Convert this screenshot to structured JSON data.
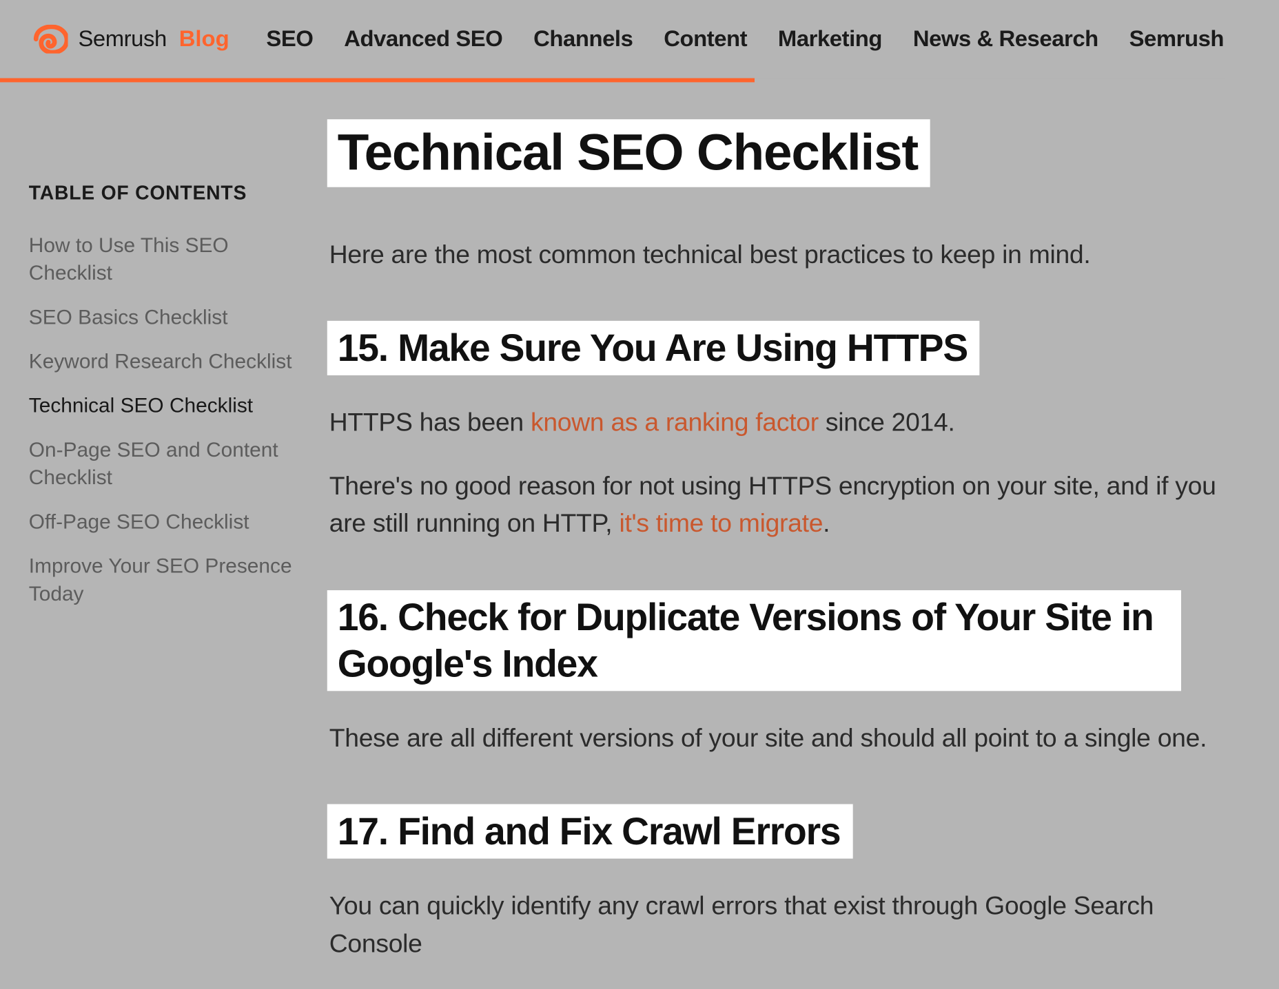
{
  "header": {
    "brand_name": "Semrush",
    "brand_blog": "Blog",
    "nav": [
      "SEO",
      "Advanced SEO",
      "Channels",
      "Content",
      "Marketing",
      "News & Research",
      "Semrush"
    ]
  },
  "toc": {
    "title": "TABLE OF CONTENTS",
    "items": [
      {
        "label": "How to Use This SEO Checklist",
        "active": false
      },
      {
        "label": "SEO Basics Checklist",
        "active": false
      },
      {
        "label": "Keyword Research Checklist",
        "active": false
      },
      {
        "label": "Technical SEO Checklist",
        "active": true
      },
      {
        "label": "On-Page SEO and Content Checklist",
        "active": false
      },
      {
        "label": "Off-Page SEO Checklist",
        "active": false
      },
      {
        "label": "Improve Your SEO Presence Today",
        "active": false
      }
    ]
  },
  "article": {
    "h1": "Technical SEO Checklist",
    "intro": "Here are the most common technical best practices to keep in mind.",
    "s15": {
      "heading": "15. Make Sure You Are Using HTTPS",
      "p1_a": "HTTPS has been ",
      "p1_link": "known as a ranking factor",
      "p1_b": " since 2014.",
      "p2_a": "There's no good reason for not using HTTPS encryption on your site, and if you are still running on HTTP, ",
      "p2_link": "it's time to migrate",
      "p2_b": "."
    },
    "s16": {
      "heading": "16. Check for Duplicate Versions of Your Site in Google's Index",
      "p1": "These are all different versions of your site and should all point to a single one."
    },
    "s17": {
      "heading": "17. Find and Fix Crawl Errors",
      "p1": "You can quickly identify any crawl errors that exist through Google Search Console"
    }
  }
}
